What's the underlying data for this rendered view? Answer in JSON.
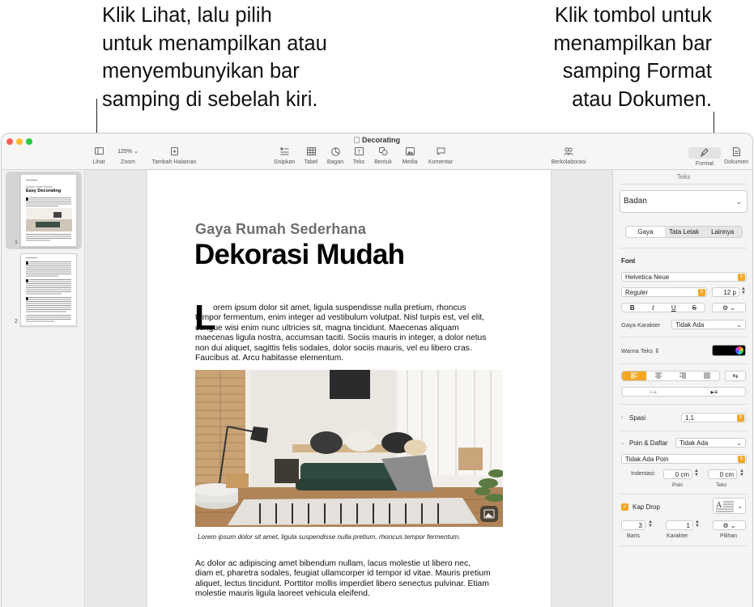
{
  "callouts": {
    "left": [
      "Klik Lihat, lalu pilih",
      "untuk menampilkan atau",
      "menyembunyikan bar",
      "samping di sebelah kiri."
    ],
    "right": [
      "Klik tombol untuk",
      "menampilkan bar",
      "samping Format",
      "atau Dokumen."
    ]
  },
  "window": {
    "title": "Decorating",
    "traffic_colors": [
      "#ff5f57",
      "#febc2e",
      "#28c840"
    ]
  },
  "toolbar": {
    "view_label": "Lihat",
    "zoom_value": "125%",
    "zoom_label": "Zoom",
    "add_page_label": "Tambah Halaman",
    "insert_label": "Sisipkan",
    "table_label": "Tabel",
    "chart_label": "Bagan",
    "text_label": "Teks",
    "shape_label": "Bentuk",
    "media_label": "Media",
    "comment_label": "Komentar",
    "collaborate_label": "Berkolaborasi",
    "format_label": "Format",
    "document_label": "Dokumen"
  },
  "sidebar": {
    "pages": [
      {
        "number": "1",
        "subtitle": "Simple Home Styling",
        "title": "Easy Decorating"
      },
      {
        "number": "2"
      }
    ]
  },
  "page": {
    "subtitle": "Gaya Rumah Sederhana",
    "title": "Dekorasi Mudah",
    "dropcap": "L",
    "body1_first": "orem ipsum dolor sit amet, ligula suspendisse nulla pretium, rhoncus",
    "body1_rest": "tempor fermentum, enim integer ad vestibulum volutpat. Nisl turpis est, vel elit, congue wisi enim nunc ultricies sit, magna tincidunt. Maecenas aliquam maecenas ligula nostra, accumsan taciti. Sociis mauris in integer, a dolor netus non dui aliquet, sagittis felis sodales, dolor sociis mauris, vel eu libero cras. Faucibus at. Arcu habitasse elementum.",
    "caption": "Lorem ipsum dolor sit amet, ligula suspendisse nulla pretium, rhoncus tempor fermentum.",
    "body2": "Ac dolor ac adipiscing amet bibendum nullam, lacus molestie ut libero nec, diam et, pharetra sodales, feugiat ullamcorper id tempor id vitae. Mauris pretium aliquet, lectus tincidunt. Porttitor mollis imperdiet libero senectus pulvinar. Etiam molestie mauris ligula laoreet vehicula eleifend."
  },
  "inspector": {
    "header": "Teks",
    "paragraph_style": "Badan",
    "tabs": [
      "Gaya",
      "Tata Letak",
      "Lainnya"
    ],
    "font_section": "Font",
    "font_family": "Helvetica Neue",
    "font_style": "Reguler",
    "font_size": "12 p",
    "format_buttons": [
      "B",
      "I",
      "U",
      "S"
    ],
    "char_style_label": "Gaya Karakter",
    "char_style_value": "Tidak Ada",
    "text_color_label": "Warna Teks",
    "text_color": "#000000",
    "spacing_label": "Spasi",
    "spacing_value": "1,1",
    "bullets_label": "Poin & Daftar",
    "bullets_value": "Tidak Ada",
    "bullet_type": "Tidak Ada Poin",
    "indent_label": "Indentasi:",
    "indent_bullet": "0 cm",
    "indent_text": "0 cm",
    "indent_bullet_label": "Poin",
    "indent_text_label": "Teks",
    "dropcap_label": "Kap Drop",
    "dropcap_lines": "3",
    "dropcap_chars": "1",
    "lines_label": "Baris",
    "chars_label": "Karakter",
    "options_label": "Pilihan",
    "accent_color": "#f5a623"
  }
}
